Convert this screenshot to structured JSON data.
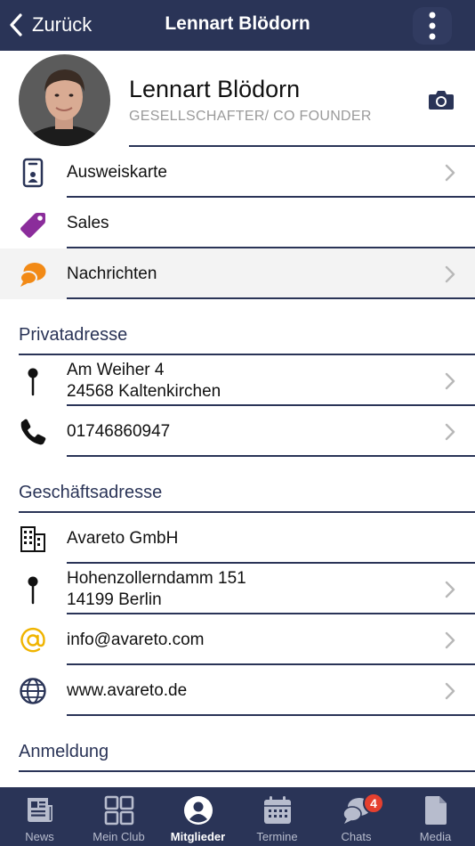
{
  "header": {
    "back_label": "Zurück",
    "title": "Lennart Blödorn"
  },
  "profile": {
    "name": "Lennart Blödorn",
    "role": "GESELLSCHAFTER/ CO FOUNDER"
  },
  "links": [
    {
      "label": "Ausweiskarte",
      "icon": "id-card-icon"
    },
    {
      "label": "Sales",
      "icon": "tag-icon"
    },
    {
      "label": "Nachrichten",
      "icon": "chat-bubbles-icon"
    }
  ],
  "private": {
    "section_title": "Privatadresse",
    "address_line1": "Am Weiher 4",
    "address_line2": "24568 Kaltenkirchen",
    "phone": "01746860947"
  },
  "business": {
    "section_title": "Geschäftsadresse",
    "company": "Avareto GmbH",
    "address_line1": "Hohenzollerndamm 151",
    "address_line2": "14199 Berlin",
    "email": "info@avareto.com",
    "website": "www.avareto.de"
  },
  "login": {
    "section_title": "Anmeldung"
  },
  "tabs": [
    {
      "label": "News",
      "icon": "news-icon"
    },
    {
      "label": "Mein Club",
      "icon": "grid-icon"
    },
    {
      "label": "Mitglieder",
      "icon": "user-circle-icon"
    },
    {
      "label": "Termine",
      "icon": "calendar-icon"
    },
    {
      "label": "Chats",
      "icon": "chat-icon",
      "badge": "4"
    },
    {
      "label": "Media",
      "icon": "document-icon"
    }
  ],
  "colors": {
    "navy": "#2a3457",
    "purple": "#8b2d9b",
    "orange": "#f28a16",
    "yellow": "#f0b400",
    "badge_red": "#e5402f"
  }
}
